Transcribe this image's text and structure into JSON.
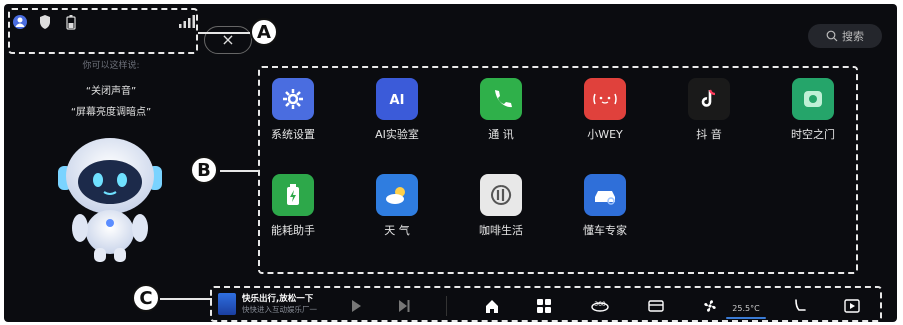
{
  "status_bar": {
    "icons": [
      "user-icon",
      "shield-icon",
      "battery-icon",
      "signal-icon"
    ]
  },
  "close_label": "×",
  "search": {
    "label": "搜索"
  },
  "assistant": {
    "prompt": "你可以这样说:",
    "hints": [
      "关闭声音",
      "屏幕亮度调暗点"
    ]
  },
  "apps": [
    {
      "label": "系统设置",
      "icon": "gear-icon",
      "color": "#4a6de0"
    },
    {
      "label": "AI实验室",
      "icon": "ai-icon",
      "color": "#3b5bd9"
    },
    {
      "label": "通 讯",
      "icon": "phone-icon",
      "color": "#2fb04a"
    },
    {
      "label": "小WEY",
      "icon": "face-icon",
      "color": "#e0413c"
    },
    {
      "label": "抖 音",
      "icon": "tiktok-icon",
      "color": "#1a1a1a"
    },
    {
      "label": "时空之门",
      "icon": "door-icon",
      "color": "#25a56a"
    },
    {
      "label": "能耗助手",
      "icon": "battery-charge-icon",
      "color": "#2da84a"
    },
    {
      "label": "天 气",
      "icon": "weather-icon",
      "color": "#2f7de0"
    },
    {
      "label": "咖啡生活",
      "icon": "coffee-icon",
      "color": "#e8e8e8"
    },
    {
      "label": "懂车专家",
      "icon": "car-icon",
      "color": "#2f6fd9"
    }
  ],
  "callouts": [
    "A",
    "B",
    "C"
  ],
  "taskbar": {
    "music": {
      "title": "快乐出行,放松一下",
      "subtitle": "快快进入互动娱乐厂一"
    },
    "temperature": "25.5°C",
    "items": [
      "play-icon",
      "next-icon",
      "home-icon",
      "apps-icon",
      "360-icon",
      "seat-icon",
      "fan-icon",
      "temperature-readout",
      "seat-heat-icon",
      "screen-share-icon"
    ]
  },
  "colors": {
    "background": "#0b0c10",
    "dashed": "#e8e8e8"
  }
}
